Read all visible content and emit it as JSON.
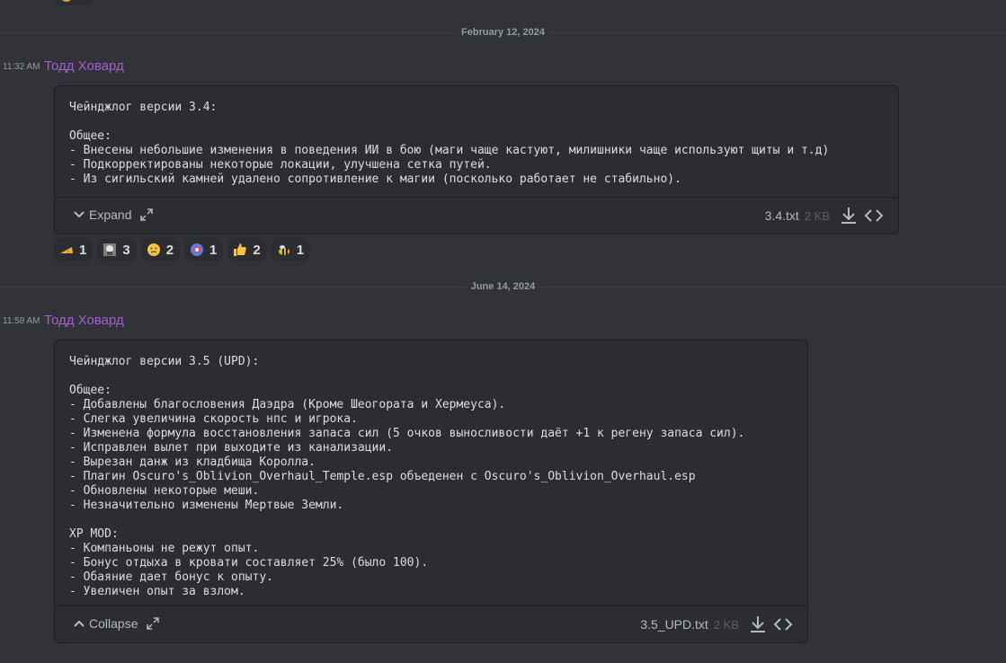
{
  "dividers": [
    {
      "label": "February 12, 2024"
    },
    {
      "label": "June 14, 2024"
    }
  ],
  "messages": [
    {
      "timestamp": "11:32 AM",
      "author": "Тодд Ховард",
      "content": "Чейнджлог версии 3.4:\n\nОбщее:\n- Внесены небольшие изменения в поведения ИИ в бою (маги чаще кастуют, милишники чаще используют щиты и т.д)\n- Подкорректированы некоторые локации, улучшена сетка путей.\n- Из сигильский камней удалено сопротивление к магии (посколько работает не стабильно).",
      "toggle_label": "Expand",
      "file_name": "3.4.txt",
      "file_size": "2 KB"
    },
    {
      "timestamp": "11:58 AM",
      "author": "Тодд Ховард",
      "content": "Чейнджлог версии 3.5 (UPD):\n\nОбщее:\n- Добавлены благословения Даэдра (Кроме Шеогората и Хермеуса).\n- Слегка увеличина скорость нпс и игрока.\n- Изменена формула восстановления запаса сил (5 очков выносливости даёт +1 к регену запаса сил).\n- Исправлен вылет при выходите из канализации.\n- Вырезан данж из кладбища Королла.\n- Плагин Oscuro's_Oblivion_Overhaul_Temple.esp объеденен с Oscuro's_Oblivion_Overhaul.esp\n- Обновлены некоторые меши.\n- Незначительно изменены Мертвые Земли.\n\nXP MOD:\n- Компаньоны не режут опыт.\n- Бонус отдыха в кровати составляет 25% (было 100).\n- Обаяние дает бонус к опыту.\n- Увеличен опыт за взлом.",
      "toggle_label": "Collapse",
      "file_name": "3.5_UPD.txt",
      "file_size": "2 KB"
    }
  ],
  "reactions": [
    {
      "emoji": "cheese-emoji",
      "count": "1",
      "color": "#f2b33d"
    },
    {
      "emoji": "skull-portrait-emoji",
      "count": "3",
      "color": "#9aa0a6"
    },
    {
      "emoji": "smirk-face-emoji",
      "count": "2",
      "color": "#f5c542"
    },
    {
      "emoji": "globe-emoji",
      "count": "1",
      "color": "#5b7cf0"
    },
    {
      "emoji": "thumbs-up-emoji",
      "count": "2",
      "color": "#f5c542"
    },
    {
      "emoji": "bee-emoji",
      "count": "1",
      "color": "#e0b020"
    }
  ],
  "colors": {
    "background": "#313338",
    "author": "#a35fd1",
    "attachment_bg": "#2b2d31"
  }
}
